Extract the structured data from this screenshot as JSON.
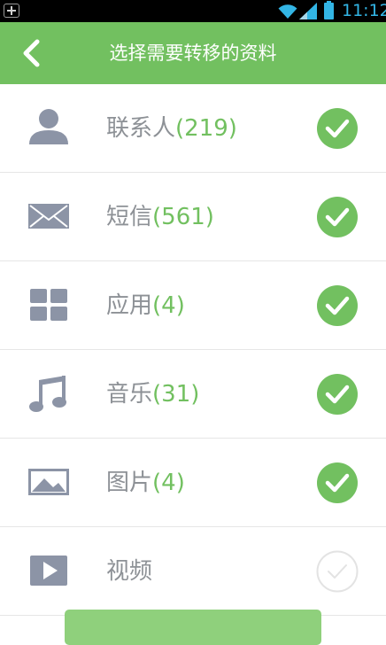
{
  "statusbar": {
    "time": "11:12"
  },
  "header": {
    "title": "选择需要转移的资料"
  },
  "items": [
    {
      "label": "联系人",
      "count": "(219)",
      "checked": true
    },
    {
      "label": "短信",
      "count": "(561)",
      "checked": true
    },
    {
      "label": "应用",
      "count": "(4)",
      "checked": true
    },
    {
      "label": "音乐",
      "count": "(31)",
      "checked": true
    },
    {
      "label": "图片",
      "count": "(4)",
      "checked": true
    },
    {
      "label": "视频",
      "count": "",
      "checked": false
    }
  ],
  "colors": {
    "accent": "#72c060",
    "icon": "#8c94a6",
    "text": "#8d9196",
    "divider": "#e6e6e6"
  }
}
